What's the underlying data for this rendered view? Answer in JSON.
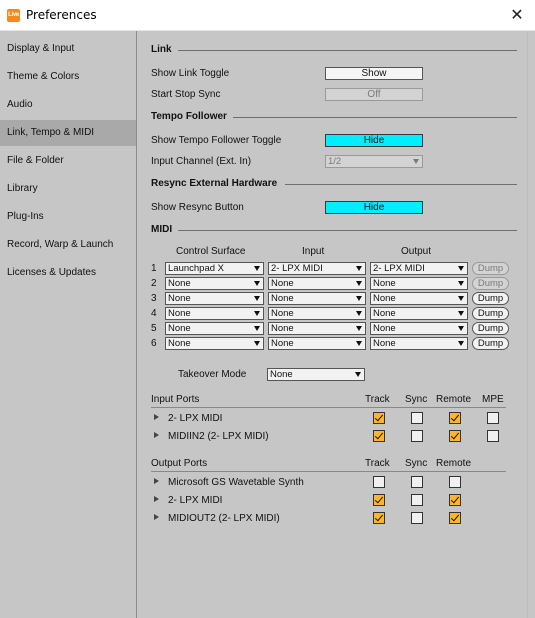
{
  "window": {
    "title": "Preferences",
    "app_badge": "Live"
  },
  "sidebar": {
    "items": [
      {
        "label": "Display & Input"
      },
      {
        "label": "Theme & Colors"
      },
      {
        "label": "Audio"
      },
      {
        "label": "Link, Tempo & MIDI",
        "active": true
      },
      {
        "label": "File & Folder"
      },
      {
        "label": "Library"
      },
      {
        "label": "Plug-Ins"
      },
      {
        "label": "Record, Warp & Launch"
      },
      {
        "label": "Licenses & Updates"
      }
    ]
  },
  "link": {
    "heading": "Link",
    "show_link_toggle": {
      "label": "Show Link Toggle",
      "value": "Show"
    },
    "start_stop_sync": {
      "label": "Start Stop Sync",
      "value": "Off"
    }
  },
  "tempo_follower": {
    "heading": "Tempo Follower",
    "show_toggle": {
      "label": "Show Tempo Follower Toggle",
      "value": "Hide"
    },
    "input_channel": {
      "label": "Input Channel (Ext. In)",
      "value": "1/2"
    }
  },
  "resync": {
    "heading": "Resync External Hardware",
    "show_button": {
      "label": "Show Resync Button",
      "value": "Hide"
    }
  },
  "midi": {
    "heading": "MIDI",
    "columns": {
      "control_surface": "Control Surface",
      "input": "Input",
      "output": "Output"
    },
    "dump_label": "Dump",
    "rows": [
      {
        "num": "1",
        "surface": "Launchpad X",
        "input": "2- LPX MIDI",
        "output": "2- LPX MIDI"
      },
      {
        "num": "2",
        "surface": "None",
        "input": "None",
        "output": "None"
      },
      {
        "num": "3",
        "surface": "None",
        "input": "None",
        "output": "None"
      },
      {
        "num": "4",
        "surface": "None",
        "input": "None",
        "output": "None"
      },
      {
        "num": "5",
        "surface": "None",
        "input": "None",
        "output": "None"
      },
      {
        "num": "6",
        "surface": "None",
        "input": "None",
        "output": "None"
      }
    ],
    "takeover_mode": {
      "label": "Takeover Mode",
      "value": "None"
    }
  },
  "input_ports": {
    "heading": "Input Ports",
    "cols": {
      "track": "Track",
      "sync": "Sync",
      "remote": "Remote",
      "mpe": "MPE"
    },
    "ports": [
      {
        "name": "2- LPX MIDI",
        "track": true,
        "sync": false,
        "remote": true,
        "mpe": false
      },
      {
        "name": "MIDIIN2 (2- LPX MIDI)",
        "track": true,
        "sync": false,
        "remote": true,
        "mpe": false
      }
    ]
  },
  "output_ports": {
    "heading": "Output Ports",
    "cols": {
      "track": "Track",
      "sync": "Sync",
      "remote": "Remote"
    },
    "ports": [
      {
        "name": "Microsoft GS Wavetable Synth",
        "track": false,
        "sync": false,
        "remote": false
      },
      {
        "name": "2- LPX MIDI",
        "track": true,
        "sync": false,
        "remote": true
      },
      {
        "name": "MIDIOUT2 (2- LPX MIDI)",
        "track": true,
        "sync": false,
        "remote": true
      }
    ]
  },
  "colors": {
    "accent_cyan": "#00eeff",
    "checkbox_on": "#ffb52a",
    "sidebar_active": "#a9a9a9",
    "panel": "#c6c6c6"
  }
}
